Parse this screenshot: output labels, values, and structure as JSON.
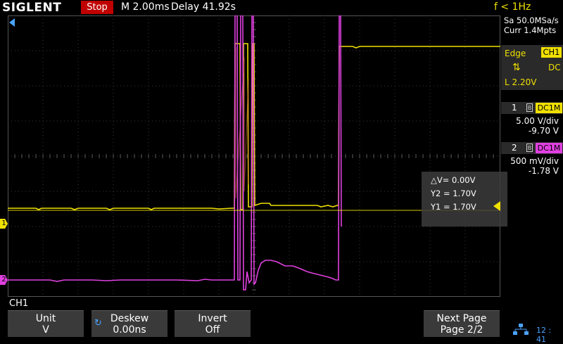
{
  "header": {
    "brand": "SIGLENT",
    "run_state": "Stop",
    "timebase": "M 2.00ms",
    "delay": "Delay 41.92s",
    "frequency": "f < 1Hz"
  },
  "acquisition": {
    "sample_rate": "Sa 50.0MSa/s",
    "memory_depth": "Curr 1.4Mpts"
  },
  "trigger": {
    "type": "Edge",
    "source": "CH1",
    "slope_icon": "rise-fall-slope-icon",
    "coupling": "DC",
    "level": "L  2.20V"
  },
  "channels": [
    {
      "num": "1",
      "bw_icon": "B",
      "coupling": "DC1M",
      "vdiv": "5.00 V/div",
      "offset": "-9.70 V",
      "color": "#f0e000"
    },
    {
      "num": "2",
      "bw_icon": "B",
      "coupling": "DC1M",
      "vdiv": "500 mV/div",
      "offset": "-1.78 V",
      "color": "#e040e0"
    }
  ],
  "cursor_readout": {
    "delta_v": "△V= 0.00V",
    "y2": "Y2 = 1.70V",
    "y1": "Y1 = 1.70V"
  },
  "markers": {
    "ch1": "1",
    "ch2": "2"
  },
  "menu": {
    "channel_label": "CH1",
    "softkeys": [
      {
        "title": "Unit",
        "value": "V"
      },
      {
        "title": "Deskew",
        "value": "0.00ns"
      },
      {
        "title": "Invert",
        "value": "Off"
      },
      {
        "title": "Next Page",
        "value": "Page 2/2"
      }
    ]
  },
  "status": {
    "network_icon": "network-icon",
    "clock": "12 : 41"
  },
  "colors": {
    "ch1": "#f0e000",
    "ch2": "#e040e0",
    "stop_bg": "#c00000",
    "accent_blue": "#4aa3ff"
  }
}
